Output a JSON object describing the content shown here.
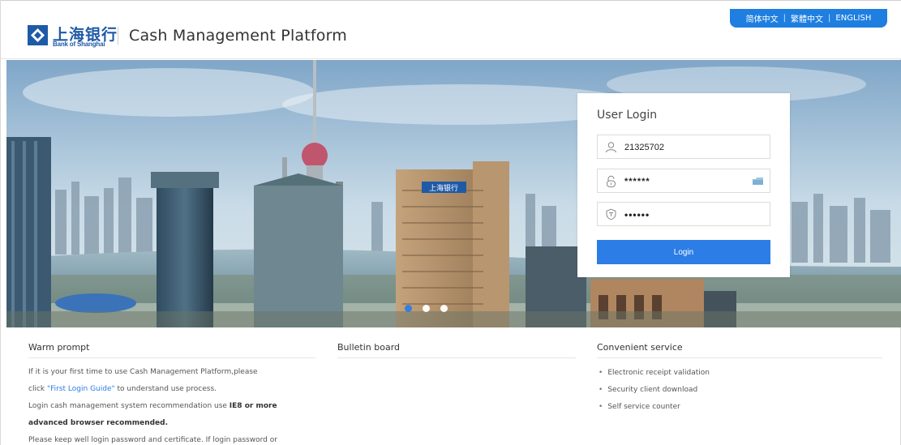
{
  "header": {
    "logo_cn": "上海银行",
    "logo_en": "Bank of Shanghai",
    "title": "Cash Management Platform",
    "languages": [
      "简体中文",
      "繁體中文",
      "ENGLISH"
    ],
    "brand_color": "#1f5aa6",
    "accent_color": "#1e7fe0"
  },
  "login": {
    "title": "User Login",
    "username": "21325702",
    "password": "******",
    "code": "••••••",
    "button": "Login"
  },
  "banner": {
    "building_sign": "上海银行",
    "carousel": {
      "total": 3,
      "active": 1
    }
  },
  "warm_prompt": {
    "title": "Warm prompt",
    "line1": "If it is your first time to use Cash Management Platform,please",
    "line2_pre": "click ",
    "line2_link": "\"First Login Guide\"",
    "line2_post": " to understand use process.",
    "line3_pre": "Login cash management system recommendation use ",
    "line3_bold": "IE8 or more",
    "line4": "advanced browser recommended.",
    "line5": "Please keep well login password and certificate. If login password or"
  },
  "bulletin": {
    "title": "Bulletin board"
  },
  "service": {
    "title": "Convenient service",
    "items": [
      "Electronic receipt validation",
      "Security client download",
      "Self service counter"
    ]
  }
}
